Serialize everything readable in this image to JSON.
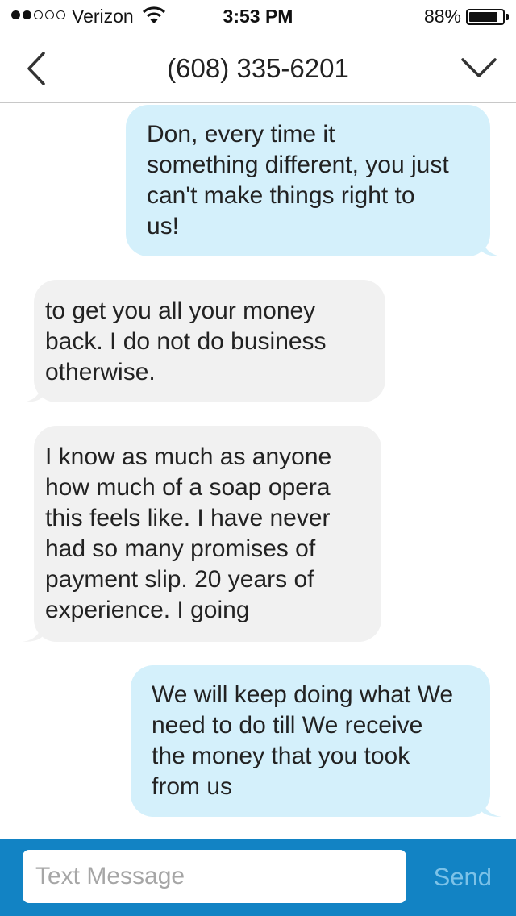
{
  "status_bar": {
    "carrier": "Verizon",
    "time": "3:53 PM",
    "battery_percent": "88%",
    "battery_level": 0.88,
    "signal_bars_filled": 2,
    "signal_bars_total": 5
  },
  "nav": {
    "title": "(608) 335-6201",
    "back_icon": "chevron-left-icon",
    "menu_icon": "chevron-down-icon"
  },
  "messages": [
    {
      "direction": "outgoing",
      "text": "Don, every time it\nsomething different, you just\ncan't make things right to\nus!"
    },
    {
      "direction": "incoming",
      "text": "to get you all your money\nback.  I do not do business\notherwise."
    },
    {
      "direction": "incoming",
      "text": "I know as much as anyone\nhow much of a soap opera\nthis feels like.  I have never\nhad so many promises of\npayment slip.  20 years of\nexperience.  I  going"
    },
    {
      "direction": "outgoing",
      "text": "We will keep doing what We\nneed to do till We receive\nthe money that you took\nfrom us"
    }
  ],
  "compose": {
    "placeholder": "Text Message",
    "send_label": "Send"
  },
  "colors": {
    "outgoing_bubble": "#d4f0fb",
    "incoming_bubble": "#f1f1f1",
    "compose_bar": "#1283c4",
    "send_disabled": "#7cc2e8"
  }
}
